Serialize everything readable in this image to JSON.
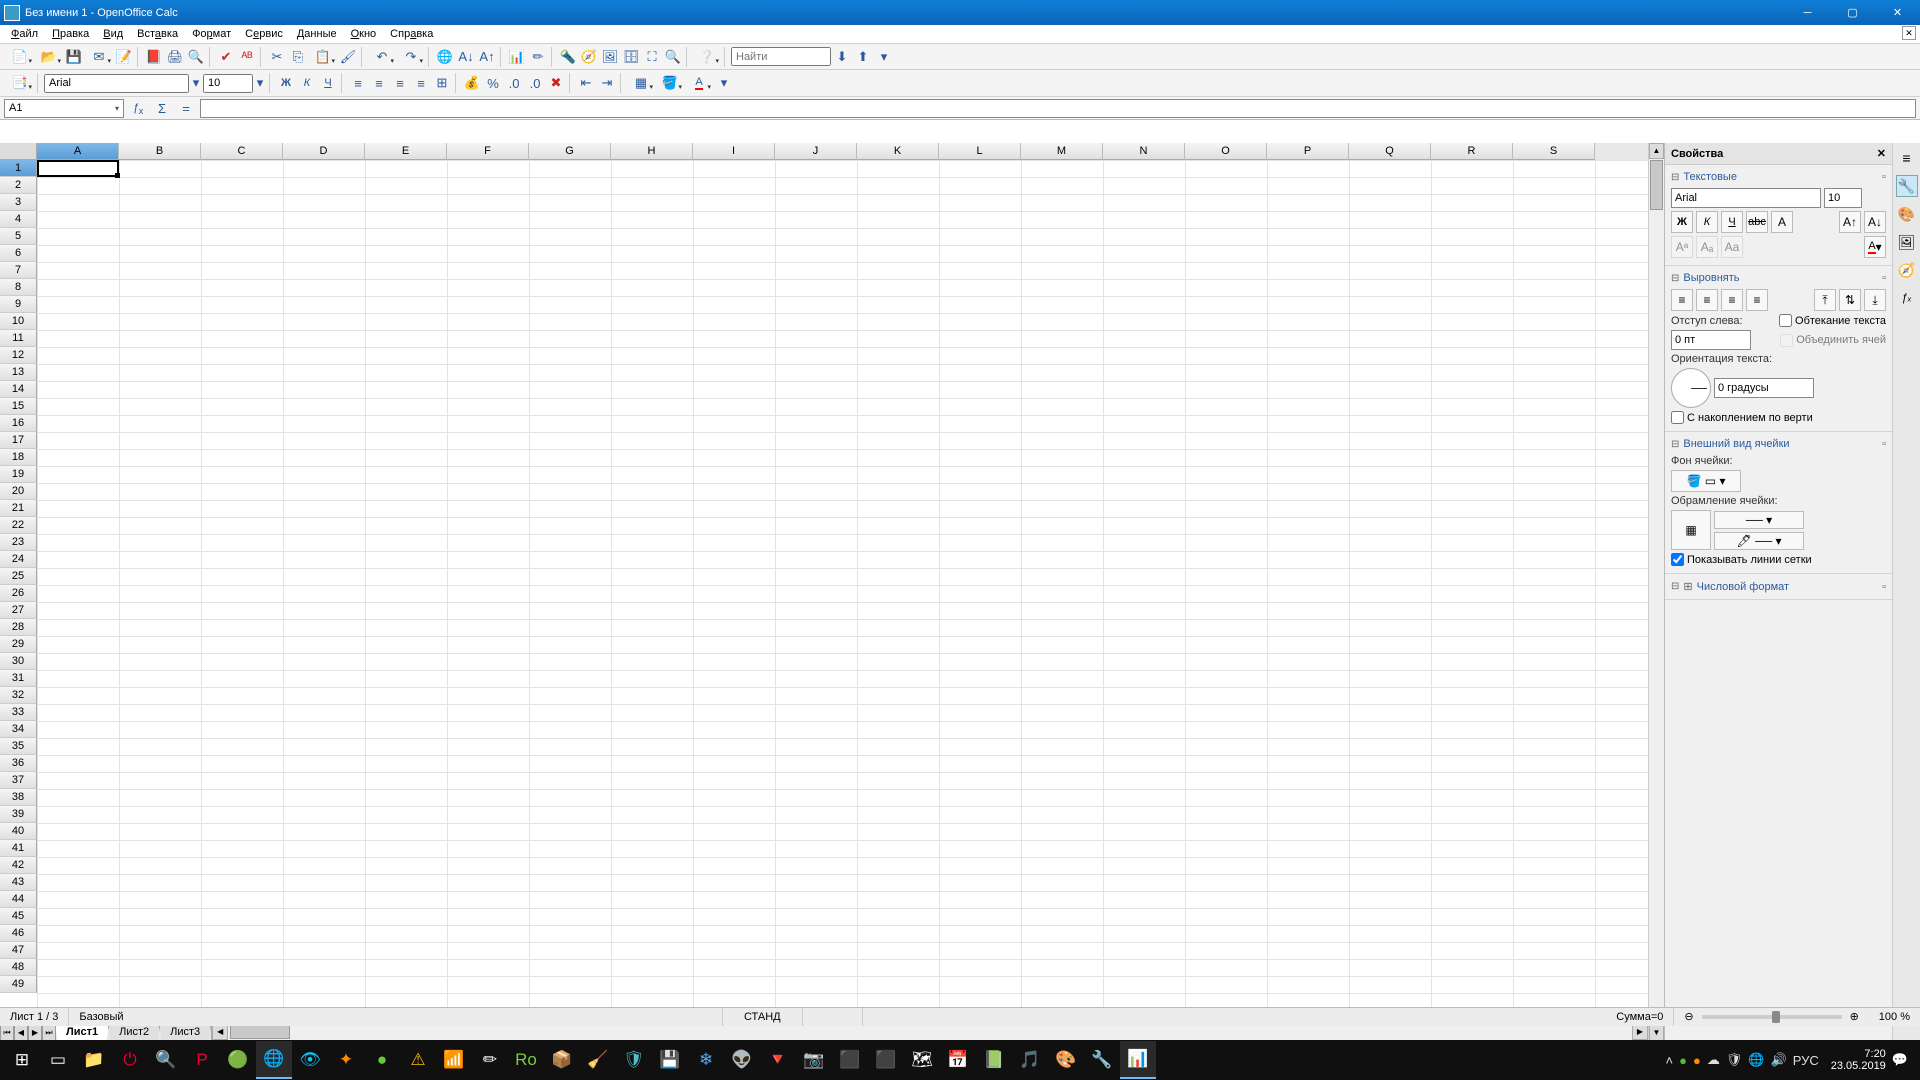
{
  "window": {
    "title": "Без имени 1 - OpenOffice Calc"
  },
  "menu": [
    "Файл",
    "Правка",
    "Вид",
    "Вставка",
    "Формат",
    "Сервис",
    "Данные",
    "Окно",
    "Справка"
  ],
  "toolbar2": {
    "search_placeholder": "Найти"
  },
  "format": {
    "font": "Arial",
    "size": "10"
  },
  "formula": {
    "cell": "A1",
    "value": ""
  },
  "columns": [
    "A",
    "B",
    "C",
    "D",
    "E",
    "F",
    "G",
    "H",
    "I",
    "J",
    "K",
    "L",
    "M",
    "N",
    "O",
    "P",
    "Q",
    "R",
    "S"
  ],
  "rows": 49,
  "tabs": [
    "Лист1",
    "Лист2",
    "Лист3"
  ],
  "status": {
    "sheet": "Лист 1 / 3",
    "style": "Базовый",
    "mode": "СТАНД",
    "sum": "Сумма=0",
    "zoom": "100 %"
  },
  "sidebar": {
    "title": "Свойства",
    "text": {
      "title": "Текстовые",
      "font": "Arial",
      "size": "10"
    },
    "align": {
      "title": "Выров­нять",
      "indent_label": "Отступ слева:",
      "indent_val": "0 пт",
      "wrap": "Обтекание текста",
      "merge": "Объединить ячей",
      "orient_label": "Ориентация текста:",
      "orient_val": "0 градусы",
      "stack": "С накоплением по верти"
    },
    "cell": {
      "title": "Внешний вид ячейки",
      "bg_label": "Фон ячейки:",
      "border_label": "Обрамление ячейки:",
      "grid": "Показывать линии сетки"
    },
    "num": {
      "title": "Числовой формат"
    }
  },
  "clock": {
    "time": "7:20",
    "date": "23.05.2019",
    "lang": "РУС"
  }
}
